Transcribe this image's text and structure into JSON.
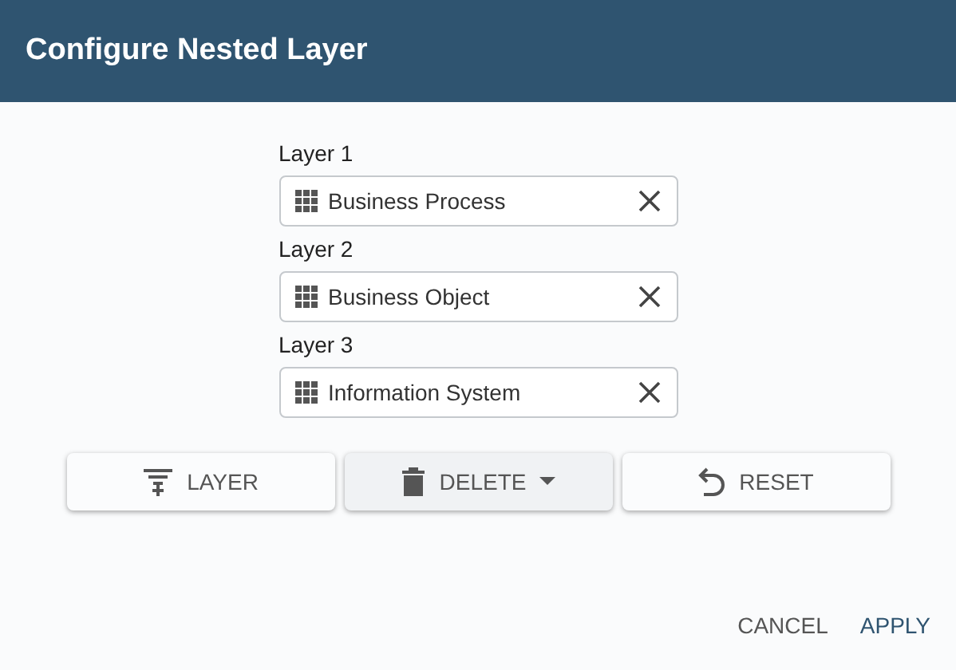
{
  "dialog": {
    "title": "Configure Nested Layer"
  },
  "layers": [
    {
      "label": "Layer 1",
      "value": "Business Process"
    },
    {
      "label": "Layer 2",
      "value": "Business Object"
    },
    {
      "label": "Layer 3",
      "value": "Information System"
    }
  ],
  "actions": [
    {
      "kind": "add",
      "label": "LAYER"
    },
    {
      "kind": "delete",
      "label": "DELETE"
    },
    {
      "kind": "reset",
      "label": "RESET"
    }
  ],
  "footer": {
    "cancel": "CANCEL",
    "apply": "APPLY"
  }
}
